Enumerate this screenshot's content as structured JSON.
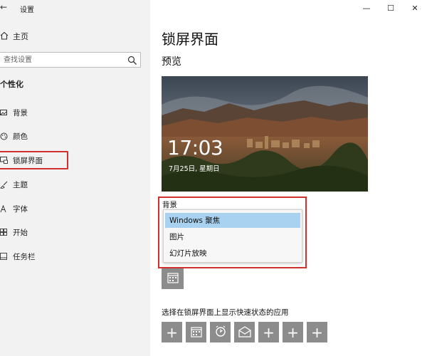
{
  "window": {
    "title": "设置",
    "controls": {
      "minimize": "—",
      "maximize": "☐",
      "close": "✕"
    }
  },
  "sidebar": {
    "home_label": "主页",
    "search_placeholder": "查找设置",
    "section_title": "个性化",
    "items": [
      {
        "label": "背景",
        "icon": "picture-icon"
      },
      {
        "label": "颜色",
        "icon": "palette-icon"
      },
      {
        "label": "锁屏界面",
        "icon": "lock-screen-icon",
        "active": true
      },
      {
        "label": "主题",
        "icon": "brush-icon"
      },
      {
        "label": "字体",
        "icon": "font-icon"
      },
      {
        "label": "开始",
        "icon": "start-icon"
      },
      {
        "label": "任务栏",
        "icon": "taskbar-icon"
      }
    ]
  },
  "main": {
    "title": "锁屏界面",
    "preview_label": "预览",
    "preview": {
      "time": "17:03",
      "date": "7月25日, 星期日"
    },
    "background_label": "背景",
    "background_options": [
      {
        "label": "Windows 聚焦",
        "selected": true
      },
      {
        "label": "图片",
        "selected": false
      },
      {
        "label": "幻灯片放映",
        "selected": false
      }
    ],
    "quick_status_label": "选择在锁屏界面上显示快速状态的应用",
    "quick_status_apps": [
      {
        "icon": "plus-icon",
        "glyph": "+"
      },
      {
        "icon": "calendar-icon",
        "glyph": ""
      },
      {
        "icon": "alarm-clock-icon",
        "glyph": ""
      },
      {
        "icon": "mail-icon",
        "glyph": ""
      },
      {
        "icon": "plus-icon",
        "glyph": "+"
      },
      {
        "icon": "plus-icon",
        "glyph": "+"
      },
      {
        "icon": "plus-icon",
        "glyph": "+"
      }
    ]
  },
  "colors": {
    "highlight_border": "#d0312d",
    "selection": "#a8d2f0",
    "tile": "#8c8c8c",
    "sidebar_bg": "#f2f2f2"
  }
}
